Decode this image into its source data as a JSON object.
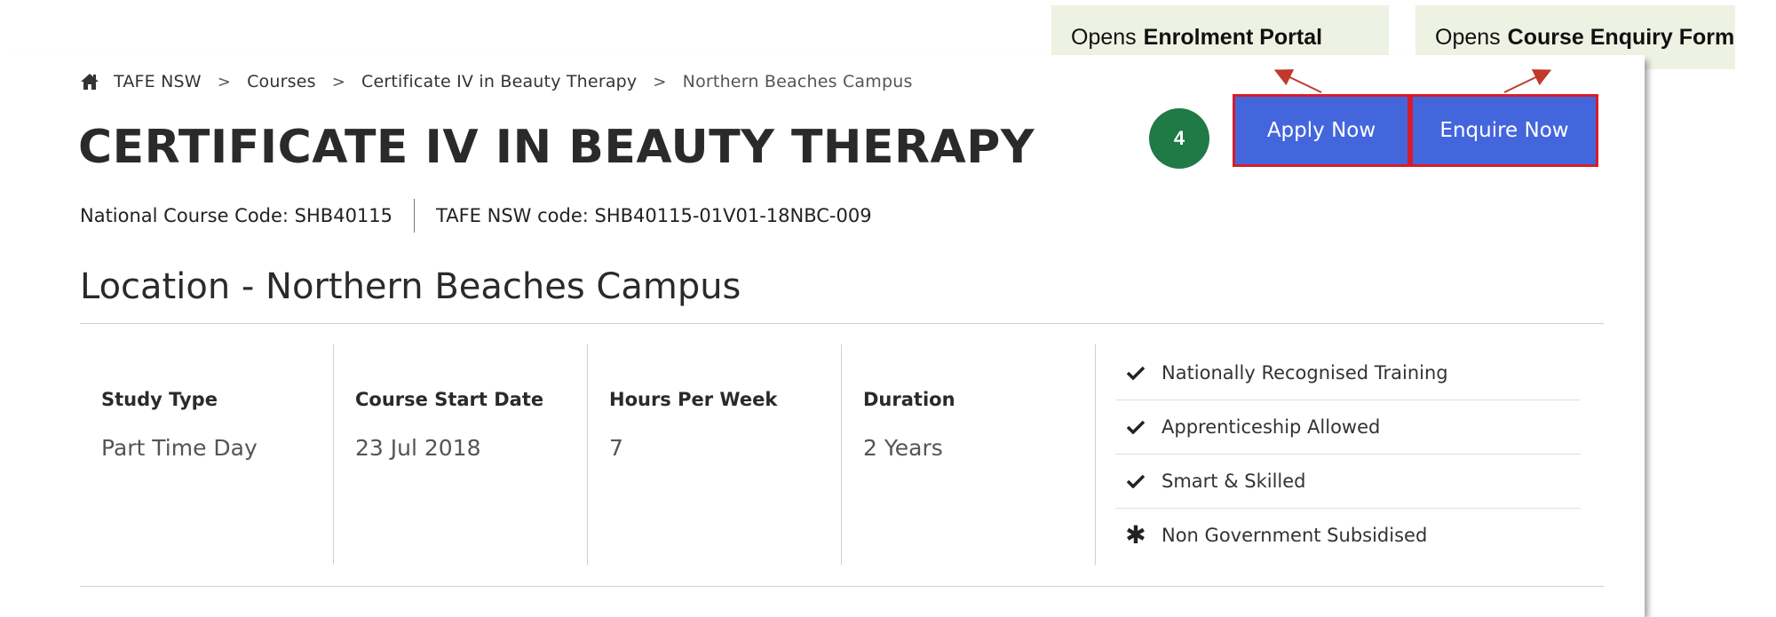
{
  "breadcrumb": {
    "items": [
      "TAFE NSW",
      "Courses",
      "Certificate IV in Beauty Therapy"
    ],
    "current": "Northern Beaches Campus",
    "separator": ">"
  },
  "course": {
    "title": "CERTIFICATE IV IN BEAUTY THERAPY",
    "national_code": "National Course Code: SHB40115",
    "tafe_code": "TAFE NSW code: SHB40115-01V01-18NBC-009"
  },
  "location": {
    "heading": "Location - Northern Beaches Campus"
  },
  "details": [
    {
      "label": "Study Type",
      "value": "Part Time Day"
    },
    {
      "label": "Course Start Date",
      "value": "23 Jul 2018"
    },
    {
      "label": "Hours Per Week",
      "value": "7"
    },
    {
      "label": "Duration",
      "value": "2 Years"
    }
  ],
  "features": [
    {
      "icon": "check-icon",
      "text": "Nationally Recognised Training"
    },
    {
      "icon": "check-icon",
      "text": "Apprenticeship Allowed"
    },
    {
      "icon": "check-icon",
      "text": "Smart & Skilled"
    },
    {
      "icon": "asterisk-icon",
      "text": "Non Government Subsidised"
    }
  ],
  "actions": {
    "apply_label": "Apply Now",
    "enquire_label": "Enquire Now"
  },
  "annotations": {
    "step_number": "4",
    "apply_callout_prefix": "Opens",
    "apply_callout_target": "Enrolment Portal",
    "enquire_callout_prefix": "Opens",
    "enquire_callout_target": "Course Enquiry Form"
  },
  "colors": {
    "button": "#4466dd",
    "highlight_border": "#d81b2a",
    "step_badge": "#1f7a45",
    "callout_bg": "#eef2e3",
    "arrow": "#c0392b"
  }
}
